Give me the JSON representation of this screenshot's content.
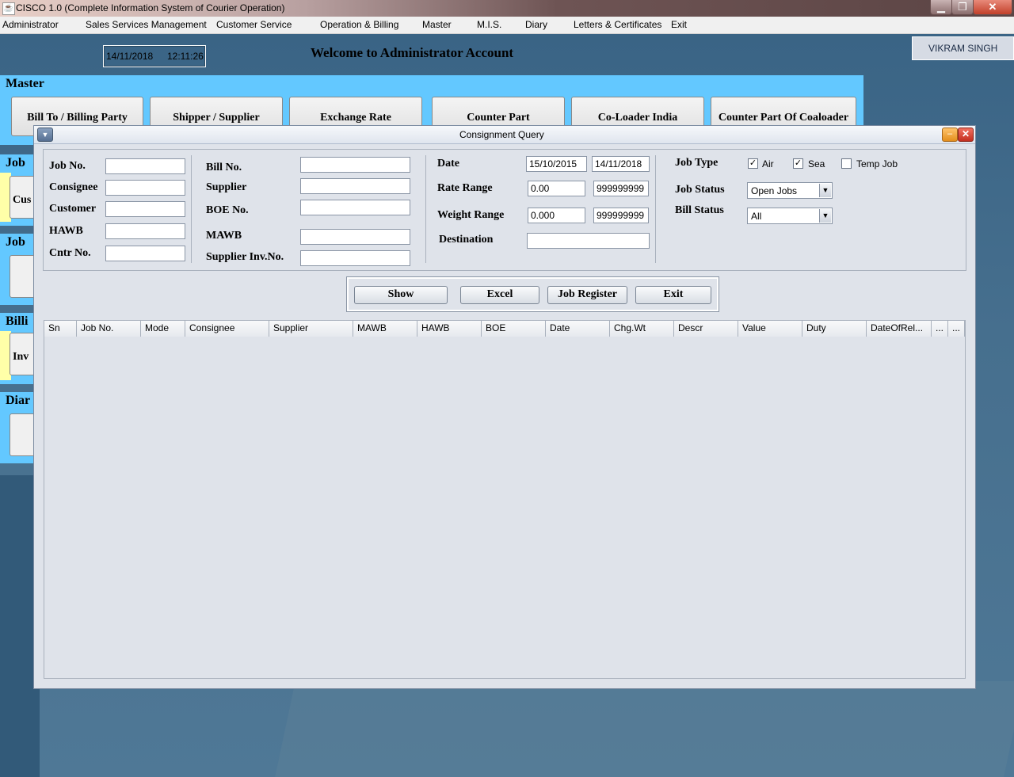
{
  "app": {
    "title": "CISCO 1.0 (Complete Information System of Courier Operation)",
    "icon": "java-cup-icon"
  },
  "menubar": {
    "items": [
      "Administrator",
      "Sales Services Management",
      "Customer Service",
      "Operation & Billing",
      "Master",
      "M.I.S.",
      "Diary",
      "Letters & Certificates",
      "Exit"
    ]
  },
  "header": {
    "date": "14/11/2018",
    "time": "12:11:26",
    "welcome": "Welcome to Administrator Account",
    "user": "VIKRAM SINGH"
  },
  "master": {
    "title": "Master",
    "buttons": [
      "Bill To / Billing Party",
      "Shipper / Supplier",
      "Exchange Rate",
      "Counter Part",
      "Co-Loader India",
      "Counter Part Of Coaloader"
    ]
  },
  "side": {
    "sections": [
      "Job",
      "Job",
      "Billi",
      "Diar"
    ],
    "buttons": [
      "Cus",
      "",
      "Inv",
      ""
    ]
  },
  "dialog": {
    "title": "Consignment Query",
    "labels": {
      "job_no": "Job No.",
      "consignee": "Consignee",
      "customer": "Customer",
      "hawb": "HAWB",
      "cntr_no": "Cntr No.",
      "bill_no": "Bill No.",
      "supplier": "Supplier",
      "boe_no": "BOE No.",
      "mawb": "MAWB",
      "supplier_inv_no": "Supplier Inv.No.",
      "date": "Date",
      "rate_range": "Rate Range",
      "weight_range": "Weight Range",
      "destination": "Destination",
      "job_type": "Job Type",
      "job_status": "Job Status",
      "bill_status": "Bill Status"
    },
    "values": {
      "date_from": "15/10/2015",
      "date_to": "14/11/2018",
      "rate_from": "0.00",
      "rate_to": "999999999",
      "weight_from": "0.000",
      "weight_to": "999999999"
    },
    "job_type": {
      "air_label": "Air",
      "air_checked": true,
      "sea_label": "Sea",
      "sea_checked": true,
      "temp_label": "Temp Job",
      "temp_checked": false
    },
    "job_status_selected": "Open Jobs",
    "bill_status_selected": "All",
    "actions": [
      "Show",
      "Excel",
      "Job Register",
      "Exit"
    ],
    "table_columns": [
      "Sn",
      "Job No.",
      "Mode",
      "Consignee",
      "Supplier",
      "MAWB",
      "HAWB",
      "BOE",
      "Date",
      "Chg.Wt",
      "Descr",
      "Value",
      "Duty",
      "DateOfRel...",
      "...",
      "..."
    ]
  }
}
